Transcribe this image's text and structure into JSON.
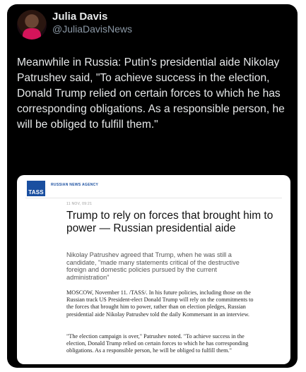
{
  "tweet": {
    "author_name": "Julia Davis",
    "author_handle": "@JuliaDavisNews",
    "text": "Meanwhile in Russia: Putin's presidential aide Nikolay Patrushev said, \"To achieve success in the election, Donald Trump relied on certain forces to which he has corresponding obligations. As a responsible person, he will be obliged to fulfill them.\""
  },
  "embed": {
    "logo_text": "TASS",
    "agency_label": "RUSSIAN NEWS AGENCY",
    "date": "11 NOV, 09:21",
    "headline": "Trump to rely on forces that brought him to power — Russian presidential aide",
    "lead": "Nikolay Patrushev agreed that Trump, when he was still a candidate, \"made many statements critical of the destructive foreign and domestic policies pursued by the current administration\"",
    "paragraph1": "MOSCOW, November 11. /TASS/. In his future policies, including those on the Russian track US President-elect Donald Trump will rely on the commitments to the forces that brought him to power, rather than on election pledges, Russian presidential aide Nikolay Patrushev told the daily Kommersant in an interview.",
    "paragraph2": "\"The election campaign is over,\" Patrushev noted. \"To achieve success in the election, Donald Trump relied on certain forces to which he has corresponding obligations. As a responsible person, he will be obliged to fulfill them.\""
  },
  "colors": {
    "card_background": "#000000",
    "name_text": "#e7e9ea",
    "handle_text": "#8b98a5",
    "tass_blue": "#1a4fa0"
  },
  "icons": {
    "avatar": "avatar-photo"
  }
}
